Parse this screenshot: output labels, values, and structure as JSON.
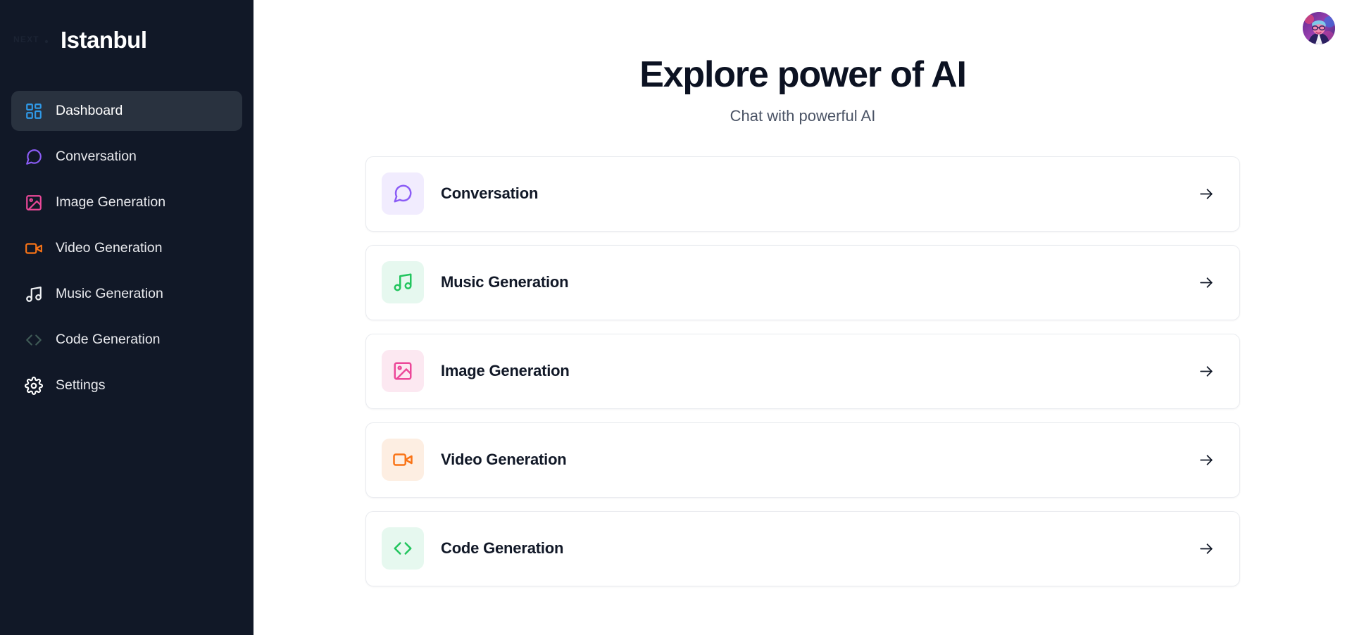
{
  "sidebar": {
    "logo_text": "NEXT",
    "brand_title": "Istanbul",
    "items": [
      {
        "label": "Dashboard",
        "icon": "dashboard-grid-icon",
        "color": "#2f9ae8",
        "active": true
      },
      {
        "label": "Conversation",
        "icon": "chat-bubble-icon",
        "color": "#8b5cf6",
        "active": false
      },
      {
        "label": "Image Generation",
        "icon": "image-photo-icon",
        "color": "#ec4899",
        "active": false
      },
      {
        "label": "Video Generation",
        "icon": "video-camera-icon",
        "color": "#f97316",
        "active": false
      },
      {
        "label": "Music Generation",
        "icon": "music-note-icon",
        "color": "#f1f3f6",
        "active": false
      },
      {
        "label": "Code Generation",
        "icon": "code-brackets-icon",
        "color": "#3f5a56",
        "active": false
      },
      {
        "label": "Settings",
        "icon": "gear-icon",
        "color": "#ffffff",
        "active": false
      }
    ]
  },
  "header": {
    "avatar": "user-avatar"
  },
  "main": {
    "title": "Explore power of AI",
    "subtitle": "Chat with powerful AI",
    "cards": [
      {
        "label": "Conversation",
        "icon": "chat-bubble-icon",
        "color": "#8b5cf6",
        "tile_bg": "#f1ecfe"
      },
      {
        "label": "Music Generation",
        "icon": "music-note-icon",
        "color": "#22c55e",
        "tile_bg": "#e6f8ef"
      },
      {
        "label": "Image Generation",
        "icon": "image-photo-icon",
        "color": "#ec4899",
        "tile_bg": "#fce8f1"
      },
      {
        "label": "Video Generation",
        "icon": "video-camera-icon",
        "color": "#f97316",
        "tile_bg": "#fdeee2"
      },
      {
        "label": "Code Generation",
        "icon": "code-brackets-icon",
        "color": "#22c55e",
        "tile_bg": "#e6f8ef"
      }
    ],
    "arrow_icon": "arrow-right-icon"
  }
}
